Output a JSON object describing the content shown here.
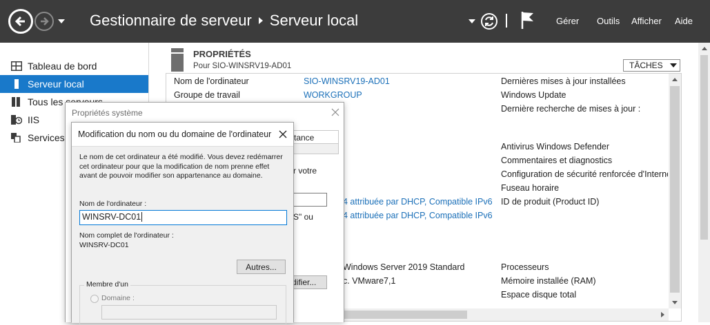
{
  "titlebar": {
    "app_name": "Gestionnaire de serveur",
    "page_name": "Serveur local",
    "menu": {
      "manage": "Gérer",
      "tools": "Outils",
      "view": "Afficher",
      "help": "Aide"
    }
  },
  "sidebar": {
    "items": [
      {
        "label": "Tableau de bord",
        "icon": "dashboard-icon"
      },
      {
        "label": "Serveur local",
        "icon": "server-icon",
        "active": true
      },
      {
        "label": "Tous les serveurs",
        "icon": "servers-icon"
      },
      {
        "label": "IIS",
        "icon": "iis-icon"
      },
      {
        "label": "Services de",
        "icon": "services-icon"
      }
    ]
  },
  "properties": {
    "heading": "PROPRIÉTÉS",
    "subheading": "Pour SIO-WINSRV19-AD01",
    "tasks_label": "TÂCHES",
    "left": [
      {
        "label": "Nom de l'ordinateur",
        "value": "SIO-WINSRV19-AD01"
      },
      {
        "label": "Groupe de travail",
        "value": "WORKGROUP"
      }
    ],
    "mid_values": [
      "4 attribuée par DHCP, Compatible IPv6",
      "4 attribuée par DHCP, Compatible IPv6",
      "Windows Server 2019 Standard",
      "c. VMware7,1"
    ],
    "right_labels": [
      "Dernières mises à jour installées",
      "Windows Update",
      "Dernière recherche de mises à jour :",
      "Antivirus Windows Defender",
      "Commentaires et diagnostics",
      "Configuration de sécurité renforcée d'Internet",
      "Fuseau horaire",
      "ID de produit (Product ID)",
      "Processeurs",
      "Mémoire installée (RAM)",
      "Espace disque total"
    ]
  },
  "sysprops": {
    "title": "Propriétés système",
    "tab_partial": "tance",
    "text1": "r votre",
    "text2": "S\" ou",
    "button_partial": "difier..."
  },
  "rename": {
    "title": "Modification du nom ou du domaine de l'ordinateur",
    "message": "Le nom de cet ordinateur a été modifié. Vous devez redémarrer cet ordinateur pour que la modification de nom prenne effet avant de pouvoir modifier son appartenance au domaine.",
    "computer_name_label": "Nom de l'ordinateur :",
    "computer_name_value": "WINSRV-DC01",
    "full_name_label": "Nom complet de l'ordinateur :",
    "full_name_value": "WINSRV-DC01",
    "more_button": "Autres...",
    "member_of_label": "Membre d'un",
    "domain_label": "Domaine :"
  }
}
